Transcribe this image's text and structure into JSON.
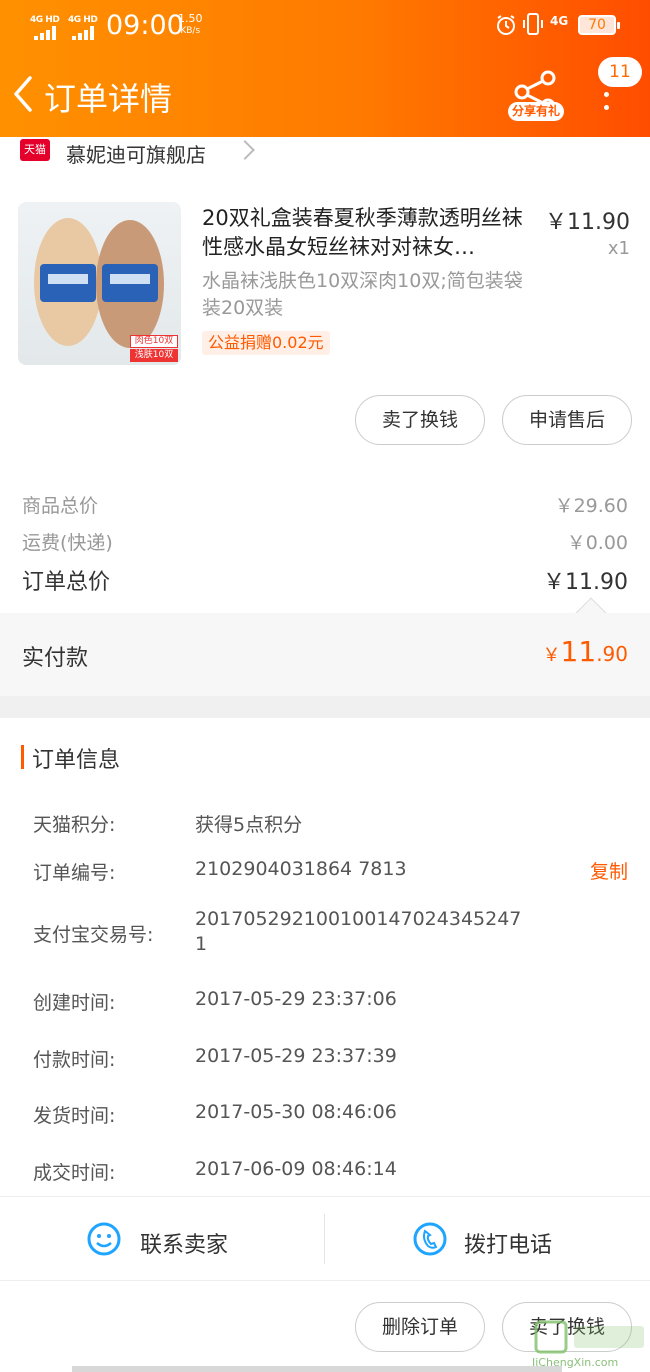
{
  "status_bar": {
    "signal_1": "4G HD",
    "signal_2": "4G HD",
    "time": "09:00",
    "speed_value": "1.50",
    "speed_unit": "KB/s",
    "network": "4G",
    "battery": "70"
  },
  "nav": {
    "title": "订单详情",
    "share_label": "分享有礼",
    "badge_count": "11"
  },
  "shop": {
    "logo_text": "天猫",
    "name": "慕妮迪可旗舰店"
  },
  "product": {
    "title": "20双礼盒装春夏秋季薄款透明丝袜性感水晶女短丝袜对对袜女…",
    "price": "￥11.90",
    "quantity": "x1",
    "sku": "水晶袜浅肤色10双深肉10双;简包装袋装20双装",
    "charity": "公益捐赠0.02元",
    "image_tag_1": "肉色10双",
    "image_tag_2": "浅肤10双"
  },
  "item_actions": {
    "sell_label": "卖了换钱",
    "after_sale_label": "申请售后"
  },
  "summary": {
    "goods_total_label": "商品总价",
    "goods_total_value": "￥29.60",
    "shipping_label": "运费(快递)",
    "shipping_value": "￥0.00",
    "order_total_label": "订单总价",
    "order_total_value": "￥11.90",
    "paid_label": "实付款",
    "paid_currency": "￥",
    "paid_int": "11",
    "paid_dec": ".90"
  },
  "order_info": {
    "section_title": "订单信息",
    "points_label": "天猫积分:",
    "points_value": "获得5点积分",
    "order_no_label": "订单编号:",
    "order_no_value": "2102904031864 7813",
    "copy_label": "复制",
    "alipay_label": "支付宝交易号:",
    "alipay_value_line1": "20170529210010014702434524​7",
    "alipay_value_line2": "1",
    "created_label": "创建时间:",
    "created_value": "2017-05-29 23:37:06",
    "paid_time_label": "付款时间:",
    "paid_time_value": "2017-05-29 23:37:39",
    "shipped_label": "发货时间:",
    "shipped_value": "2017-05-30 08:46:06",
    "deal_label": "成交时间:",
    "deal_value": "2017-06-09 08:46:14"
  },
  "contact": {
    "seller_label": "联系卖家",
    "phone_label": "拨打电话"
  },
  "bottom_actions": {
    "delete_label": "删除订单",
    "sell_label": "卖了换钱"
  },
  "watermark": {
    "text": "JiChengXin.com"
  },
  "colors": {
    "header_start": "#ff9100",
    "header_end": "#ff4d00",
    "accent": "#ff5a00",
    "tmall_red": "#e4002b",
    "contact_blue": "#1ea5ff"
  }
}
